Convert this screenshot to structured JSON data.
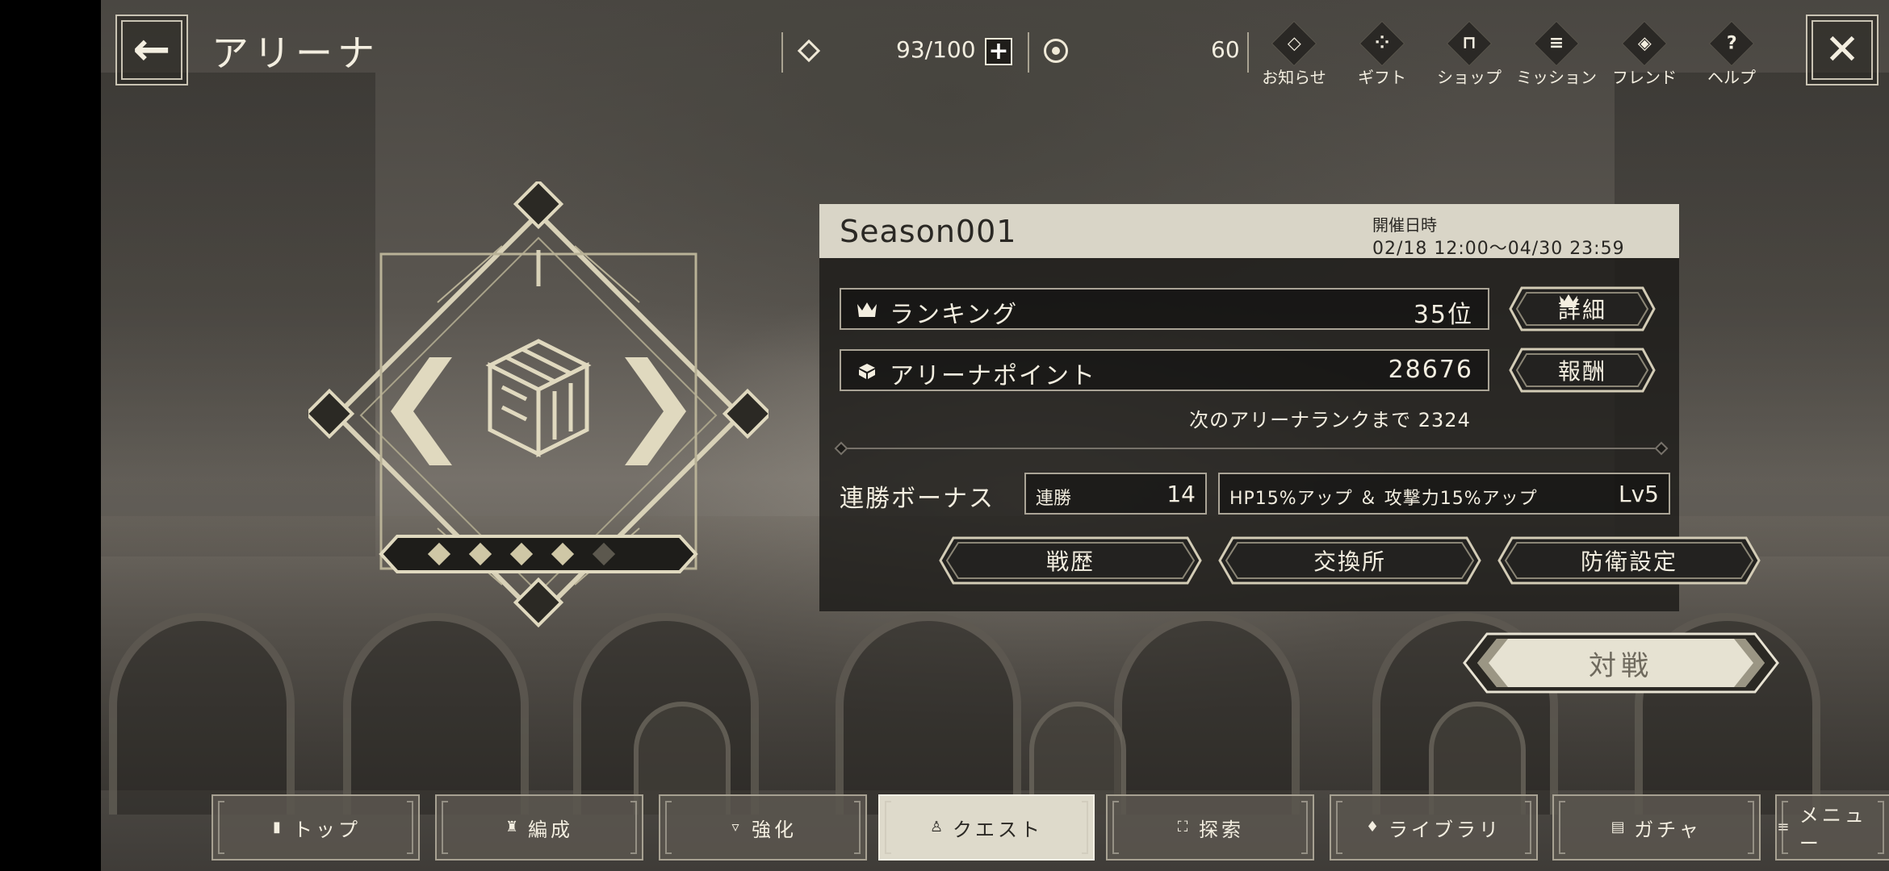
{
  "header": {
    "title": "アリーナ",
    "stamina": "93/100",
    "currency": "60"
  },
  "top_menu": [
    {
      "label": "お知らせ",
      "icon": "notice-icon"
    },
    {
      "label": "ギフト",
      "icon": "gift-icon"
    },
    {
      "label": "ショップ",
      "icon": "shop-icon"
    },
    {
      "label": "ミッション",
      "icon": "mission-icon"
    },
    {
      "label": "フレンド",
      "icon": "friend-icon"
    },
    {
      "label": "ヘルプ",
      "icon": "help-icon"
    }
  ],
  "emblem": {
    "rank_stars_filled": 4,
    "rank_stars_total": 5
  },
  "panel": {
    "season": "Season001",
    "period_label": "開催日時",
    "period_value": "02/18 12:00～04/30 23:59",
    "ranking_label": "ランキング",
    "ranking_value": "35位",
    "details_button": "詳細",
    "points_label": "アリーナポイント",
    "points_value": "28676",
    "reward_button": "報酬",
    "next_rank_text": "次のアリーナランクまで 2324",
    "bonus_label": "連勝ボーナス",
    "streak_label": "連勝",
    "streak_value": "14",
    "bonus_effect": "HP15%アップ ＆ 攻撃力15%アップ",
    "bonus_level": "Lv5",
    "history_button": "戦歴",
    "exchange_button": "交換所",
    "defense_button": "防衛設定"
  },
  "fight_button": "対戦",
  "bottom_nav": [
    {
      "label": "トップ",
      "icon": "▮"
    },
    {
      "label": "編成",
      "icon": "♜"
    },
    {
      "label": "強化",
      "icon": "▿"
    },
    {
      "label": "クエスト",
      "icon": "♙",
      "active": true
    },
    {
      "label": "探索",
      "icon": "⛶"
    },
    {
      "label": "ライブラリ",
      "icon": "♦"
    },
    {
      "label": "ガチャ",
      "icon": "▤"
    },
    {
      "label": "メニュー",
      "icon": "≡"
    }
  ]
}
